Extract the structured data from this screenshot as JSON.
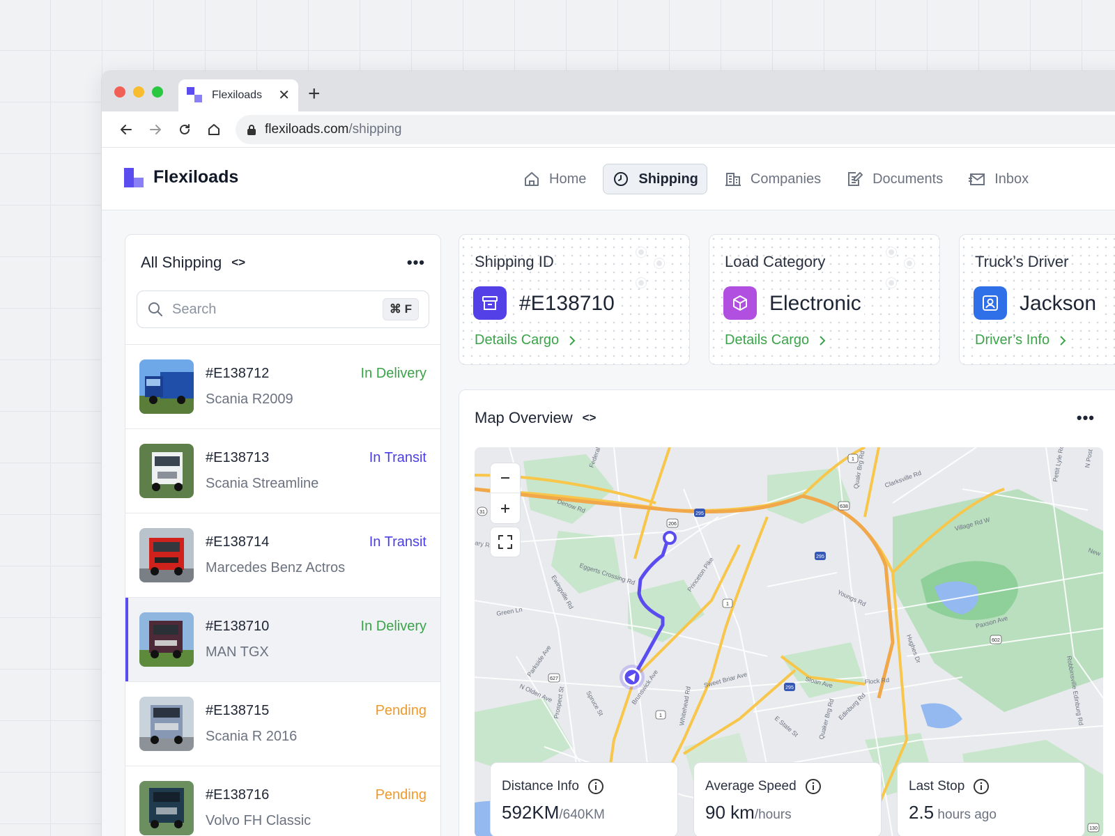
{
  "browser": {
    "tab_title": "Flexiloads",
    "url_domain": "flexiloads.com",
    "url_path": "/shipping"
  },
  "app": {
    "brand": "Flexiloads",
    "nav": [
      {
        "label": "Home",
        "icon": "home-icon"
      },
      {
        "label": "Shipping",
        "icon": "clock-icon",
        "active": true
      },
      {
        "label": "Companies",
        "icon": "building-icon"
      },
      {
        "label": "Documents",
        "icon": "document-icon"
      },
      {
        "label": "Inbox",
        "icon": "mail-icon"
      }
    ],
    "accent_color": "#5b4cf0"
  },
  "shipping_list": {
    "title": "All Shipping",
    "search_placeholder": "Search",
    "search_shortcut": "⌘ F",
    "items": [
      {
        "id": "#E138712",
        "name": "Scania R2009",
        "status": "In Delivery",
        "status_type": "delivery"
      },
      {
        "id": "#E138713",
        "name": "Scania Streamline",
        "status": "In Transit",
        "status_type": "transit"
      },
      {
        "id": "#E138714",
        "name": "Marcedes Benz Actros",
        "status": "In Transit",
        "status_type": "transit"
      },
      {
        "id": "#E138710",
        "name": "MAN TGX",
        "status": "In Delivery",
        "status_type": "delivery",
        "selected": true
      },
      {
        "id": "#E138715",
        "name": "Scania R 2016",
        "status": "Pending",
        "status_type": "pending"
      },
      {
        "id": "#E138716",
        "name": "Volvo FH Classic",
        "status": "Pending",
        "status_type": "pending"
      }
    ]
  },
  "info_cards": [
    {
      "label": "Shipping ID",
      "value": "#E138710",
      "link": "Details Cargo",
      "icon": "archive-box-icon"
    },
    {
      "label": "Load Category",
      "value": "Electronic",
      "link": "Details Cargo",
      "icon": "cube-icon"
    },
    {
      "label": "Truck’s Driver",
      "value": "Jackson",
      "link": "Driver’s Info",
      "icon": "user-icon"
    }
  ],
  "map": {
    "title": "Map Overview",
    "stats": [
      {
        "label": "Distance Info",
        "value": "592KM",
        "unit": "/640KM"
      },
      {
        "label": "Average Speed",
        "value": "90 km",
        "unit": "/hours"
      },
      {
        "label": "Last Stop",
        "value": "2.5",
        "unit": " hours ago"
      }
    ],
    "labels": [
      "Denow Rd",
      "Federal",
      "Eggerts Crossing Rd",
      "Ewingville Rd",
      "Princeton Pike",
      "Green Ln",
      "Parkside Ave",
      "N Olden Ave",
      "Spruce St",
      "Brunswick Ave",
      "Sweet Briar Ave",
      "Whitehead Rd",
      "Youngs Rd",
      "Sloan Ave",
      "Flock Rd",
      "Quaker Brg Rd",
      "Edinburg Rd",
      "E State St",
      "Clarksville Rd",
      "Village Rd W",
      "Paxson Ave",
      "Hughes Dr",
      "Robbinsville Edinburg Rd",
      "Pettit Lyle Rd",
      "N Post",
      "Quakr Brg Rd",
      "Prospect St",
      "ary Rd",
      "New"
    ],
    "shields": [
      "1",
      "295",
      "206",
      "31",
      "638",
      "602",
      "627",
      "130"
    ]
  }
}
